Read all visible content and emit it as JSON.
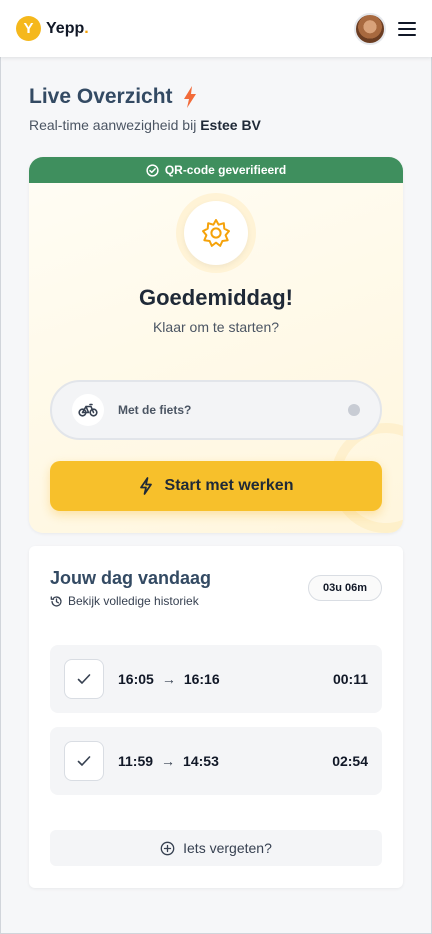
{
  "header": {
    "brand_letter": "Y",
    "brand_name": "Yepp",
    "brand_dot": ".",
    "avatar_icon": "user-avatar",
    "menu_icon": "hamburger-menu-icon"
  },
  "page": {
    "title": "Live Overzicht",
    "subtitle_prefix": "Real-time aanwezigheid bij ",
    "company": "Estee BV"
  },
  "checkin_card": {
    "verified_label": "QR-code geverifieerd",
    "greeting": "Goedemiddag!",
    "greeting_sub": "Klaar om te starten?",
    "bike_label": "Met de fiets?",
    "start_label": "Start met werken"
  },
  "day": {
    "title": "Jouw dag vandaag",
    "history_label": "Bekijk volledige historiek",
    "total": "03u 06m",
    "entries": [
      {
        "start": "16:05",
        "arrow": "→",
        "end": "16:16",
        "duration": "00:11"
      },
      {
        "start": "11:59",
        "arrow": "→",
        "end": "14:53",
        "duration": "02:54"
      }
    ],
    "forgot_label": "Iets vergeten?"
  },
  "colors": {
    "accent": "#f7c02b",
    "verified": "#3f8f5e",
    "title": "#334a63",
    "bolt": "#f26b3a"
  }
}
